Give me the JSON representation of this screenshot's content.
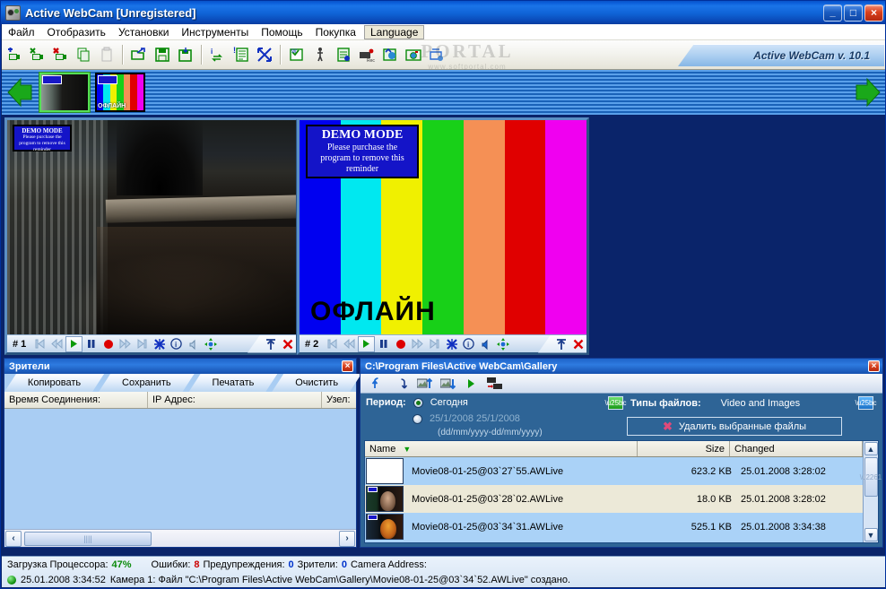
{
  "window": {
    "title": "Active WebCam [Unregistered]",
    "icon": "webcam-icon",
    "minimize": "_",
    "maximize": "□",
    "close": "×"
  },
  "menu": {
    "items": [
      {
        "label": "Файл",
        "name": "menu-file"
      },
      {
        "label": "Отобразить",
        "name": "menu-view"
      },
      {
        "label": "Установки",
        "name": "menu-settings"
      },
      {
        "label": "Инструменты",
        "name": "menu-tools"
      },
      {
        "label": "Помощь",
        "name": "menu-help"
      },
      {
        "label": "Покупка",
        "name": "menu-purchase"
      },
      {
        "label": "Language",
        "name": "menu-language"
      }
    ]
  },
  "toolbar": {
    "version_label": "Active WebCam v. 10.1",
    "watermark": {
      "line1": "PORTAL",
      "line2": "www.softportal.com"
    },
    "buttons": [
      {
        "name": "add-camera-icon",
        "title": "Add Camera"
      },
      {
        "name": "edit-camera-icon",
        "title": "Edit Camera"
      },
      {
        "name": "delete-camera-icon",
        "title": "Delete Camera"
      },
      {
        "name": "copy-icon",
        "title": "Copy"
      },
      {
        "name": "paste-icon",
        "title": "Paste"
      },
      {
        "name": "open-folder-icon",
        "title": "Open"
      },
      {
        "name": "save-icon",
        "title": "Save"
      },
      {
        "name": "save-all-icon",
        "title": "Save All"
      },
      {
        "name": "refresh-info-icon",
        "title": "Refresh"
      },
      {
        "name": "log-icon",
        "title": "Log"
      },
      {
        "name": "fullscreen-icon",
        "title": "Full Screen"
      },
      {
        "name": "broadcast-icon",
        "title": "Broadcast"
      },
      {
        "name": "motion-detect-icon",
        "title": "Motion Detection"
      },
      {
        "name": "scheduler-icon",
        "title": "Scheduler"
      },
      {
        "name": "record-icon",
        "title": "Record"
      },
      {
        "name": "publish-icon",
        "title": "Publish"
      },
      {
        "name": "snapshot-icon",
        "title": "Snapshot"
      },
      {
        "name": "settings-icon",
        "title": "Settings"
      }
    ]
  },
  "camera_strip": {
    "prev_arrow": "prev-arrow-icon",
    "next_arrow": "next-arrow-icon",
    "thumbnails": [
      {
        "name": "camera-thumb-1",
        "selected": true,
        "label": ""
      },
      {
        "name": "camera-thumb-2",
        "selected": false,
        "label": "ОФЛАЙН"
      }
    ]
  },
  "cameras": [
    {
      "id": "#  1",
      "number_label": "# 1",
      "demo": {
        "title": "DEMO MODE",
        "line1": "Please purchase the",
        "line2": "program to remove this",
        "line3": "reminder"
      },
      "overlay_text": "",
      "controls": [
        {
          "name": "skip-start-button",
          "glyph": "⏮"
        },
        {
          "name": "rewind-button",
          "glyph": "⏪"
        },
        {
          "name": "play-button",
          "glyph": "▶"
        },
        {
          "name": "pause-button",
          "glyph": "‖"
        },
        {
          "name": "record-button",
          "glyph": "●"
        },
        {
          "name": "fast-forward-button",
          "glyph": "⏩"
        },
        {
          "name": "skip-end-button",
          "glyph": "⏭"
        },
        {
          "name": "tools-button",
          "glyph": "✶"
        },
        {
          "name": "info-button",
          "glyph": "i"
        },
        {
          "name": "mute-button",
          "glyph": "◁"
        },
        {
          "name": "pan-tilt-button",
          "glyph": "✥"
        }
      ],
      "right_controls": [
        {
          "name": "pin-button",
          "glyph": "↑"
        },
        {
          "name": "close-camera-button",
          "glyph": "✖"
        }
      ]
    },
    {
      "id": "#  2",
      "number_label": "# 2",
      "demo": {
        "title": "DEMO MODE",
        "line1": "Please purchase the",
        "line2": "program to remove this",
        "line3": "reminder"
      },
      "overlay_text": "ОФЛАЙН",
      "color_bars": [
        "#0000f0",
        "#00e8f0",
        "#f0f000",
        "#18d018",
        "#f59055",
        "#e00000",
        "#f000f0"
      ],
      "controls": [
        {
          "name": "skip-start-button",
          "glyph": "⏮"
        },
        {
          "name": "rewind-button",
          "glyph": "⏪"
        },
        {
          "name": "play-button",
          "glyph": "▶"
        },
        {
          "name": "pause-button",
          "glyph": "‖"
        },
        {
          "name": "record-button",
          "glyph": "●"
        },
        {
          "name": "fast-forward-button",
          "glyph": "⏩"
        },
        {
          "name": "skip-end-button",
          "glyph": "⏭"
        },
        {
          "name": "tools-button",
          "glyph": "✶"
        },
        {
          "name": "info-button",
          "glyph": "i"
        },
        {
          "name": "mute-button",
          "glyph": "◁"
        },
        {
          "name": "pan-tilt-button",
          "glyph": "✥"
        }
      ],
      "right_controls": [
        {
          "name": "pin-button",
          "glyph": "↑"
        },
        {
          "name": "close-camera-button",
          "glyph": "✖"
        }
      ]
    }
  ],
  "viewers_panel": {
    "title": "Зрители",
    "close": "×",
    "buttons": [
      {
        "label": "Копировать",
        "name": "copy-button"
      },
      {
        "label": "Сохранить",
        "name": "save-button"
      },
      {
        "label": "Печатать",
        "name": "print-button"
      },
      {
        "label": "Очистить",
        "name": "clear-button"
      }
    ],
    "columns": [
      {
        "label": "Время Соединения:",
        "name": "col-connection-time"
      },
      {
        "label": "IP Адрес:",
        "name": "col-ip-address"
      },
      {
        "label": "Узел:",
        "name": "col-host"
      }
    ],
    "rows": [],
    "scroll_left": "‹",
    "scroll_right": "›"
  },
  "gallery_panel": {
    "title": "C:\\Program Files\\Active WebCam\\Gallery",
    "close": "×",
    "toolbar": [
      {
        "name": "up-folder-icon",
        "glyph": "↑"
      },
      {
        "name": "refresh-icon",
        "glyph": "↺"
      },
      {
        "name": "upload-image-icon",
        "glyph": "↑"
      },
      {
        "name": "download-image-icon",
        "glyph": "↓"
      },
      {
        "name": "play-icon",
        "glyph": "▶"
      },
      {
        "name": "convert-video-icon",
        "glyph": "→"
      }
    ],
    "period_label": "Период:",
    "period_today": "Сегодня",
    "period_range": "25/1/2008 25/1/2008",
    "period_format": "(dd/mm/yyyy-dd/mm/yyyy)",
    "filetypes_label": "Типы файлов:",
    "filetypes_value": "Video and Images",
    "delete_button": "Удалить выбранные файлы",
    "delete_icon": "✖",
    "columns": [
      {
        "label": "Name",
        "name": "col-name"
      },
      {
        "label": "Size",
        "name": "col-size"
      },
      {
        "label": "Changed",
        "name": "col-changed"
      }
    ],
    "sort_indicator": "▼",
    "files": [
      {
        "name": "Movie08-01-25@03`27`55.AWLive",
        "size": "623.2 KB",
        "changed": "25.01.2008  3:28:02",
        "thumb": "blank-thumb"
      },
      {
        "name": "Movie08-01-25@03`28`02.AWLive",
        "size": "18.0 KB",
        "changed": "25.01.2008  3:28:02",
        "thumb": "face-thumb-1"
      },
      {
        "name": "Movie08-01-25@03`34`31.AWLive",
        "size": "525.1 KB",
        "changed": "25.01.2008  3:34:38",
        "thumb": "face-thumb-2"
      }
    ],
    "scroll_up": "▲",
    "scroll_down": "▼"
  },
  "status_bar": {
    "cpu_label": "Загрузка Процессора:",
    "cpu_value": "47%",
    "errors_label": "Ошибки:",
    "errors_value": "8",
    "warnings_label": "Предупреждения:",
    "warnings_value": "0",
    "viewers_label": "Зрители:",
    "viewers_value": "0",
    "camera_address_label": "Camera Address:",
    "camera_address_value": "",
    "log_timestamp": "25.01.2008 3:34:52",
    "log_message": "Камера 1: Файл \"C:\\Program Files\\Active WebCam\\Gallery\\Movie08-01-25@03`34`52.AWLive\" создано."
  },
  "colors": {
    "title_bar": "#0b5ed9",
    "main_background": "#336699",
    "panel_background": "#2e6496",
    "list_selected": "#aad2f7",
    "list_alt": "#ece9d8",
    "accent_green": "#00a000",
    "accent_red": "#cc0000"
  }
}
